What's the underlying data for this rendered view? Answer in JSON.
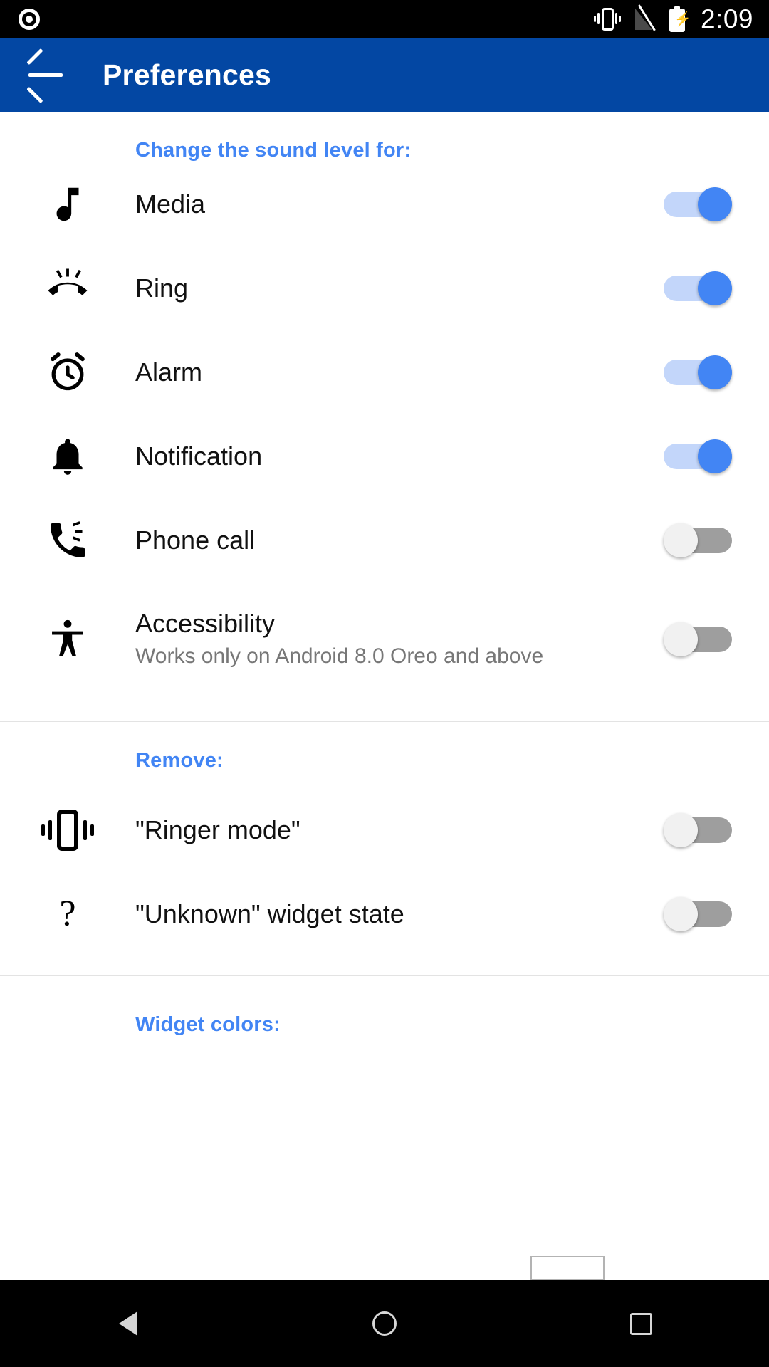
{
  "statusbar": {
    "time": "2:09",
    "icons": [
      "record-dot-icon",
      "vibrate-icon",
      "no-signal-icon",
      "battery-charging-icon"
    ]
  },
  "appbar": {
    "back_label": "back-arrow",
    "title": "Preferences"
  },
  "sections": [
    {
      "header": "Change the sound level for:",
      "rows": [
        {
          "icon": "music-note-icon",
          "title": "Media",
          "subtitle": "",
          "toggle": "on"
        },
        {
          "icon": "ringing-phone-icon",
          "title": "Ring",
          "subtitle": "",
          "toggle": "on"
        },
        {
          "icon": "alarm-clock-icon",
          "title": "Alarm",
          "subtitle": "",
          "toggle": "on"
        },
        {
          "icon": "bell-icon",
          "title": "Notification",
          "subtitle": "",
          "toggle": "on"
        },
        {
          "icon": "phone-call-icon",
          "title": "Phone call",
          "subtitle": "",
          "toggle": "off"
        },
        {
          "icon": "accessibility-icon",
          "title": "Accessibility",
          "subtitle": "Works only on Android 8.0 Oreo and above",
          "toggle": "off"
        }
      ]
    },
    {
      "header": "Remove:",
      "rows": [
        {
          "icon": "vibrate-icon",
          "title": "\"Ringer mode\"",
          "subtitle": "",
          "toggle": "off"
        },
        {
          "icon": "question-icon",
          "title": "\"Unknown\" widget state",
          "subtitle": "",
          "toggle": "off"
        }
      ]
    },
    {
      "header": "Widget colors:",
      "rows": []
    }
  ],
  "navbar": {
    "buttons": [
      "back-triangle-icon",
      "home-circle-icon",
      "recents-square-icon"
    ]
  },
  "colors": {
    "appbar_blue": "#0347a3",
    "accent_blue": "#4285f4",
    "track_on": "#c3d6fa",
    "track_off": "#9e9e9e",
    "title_text": "#111111",
    "subtitle_text": "#777777"
  }
}
